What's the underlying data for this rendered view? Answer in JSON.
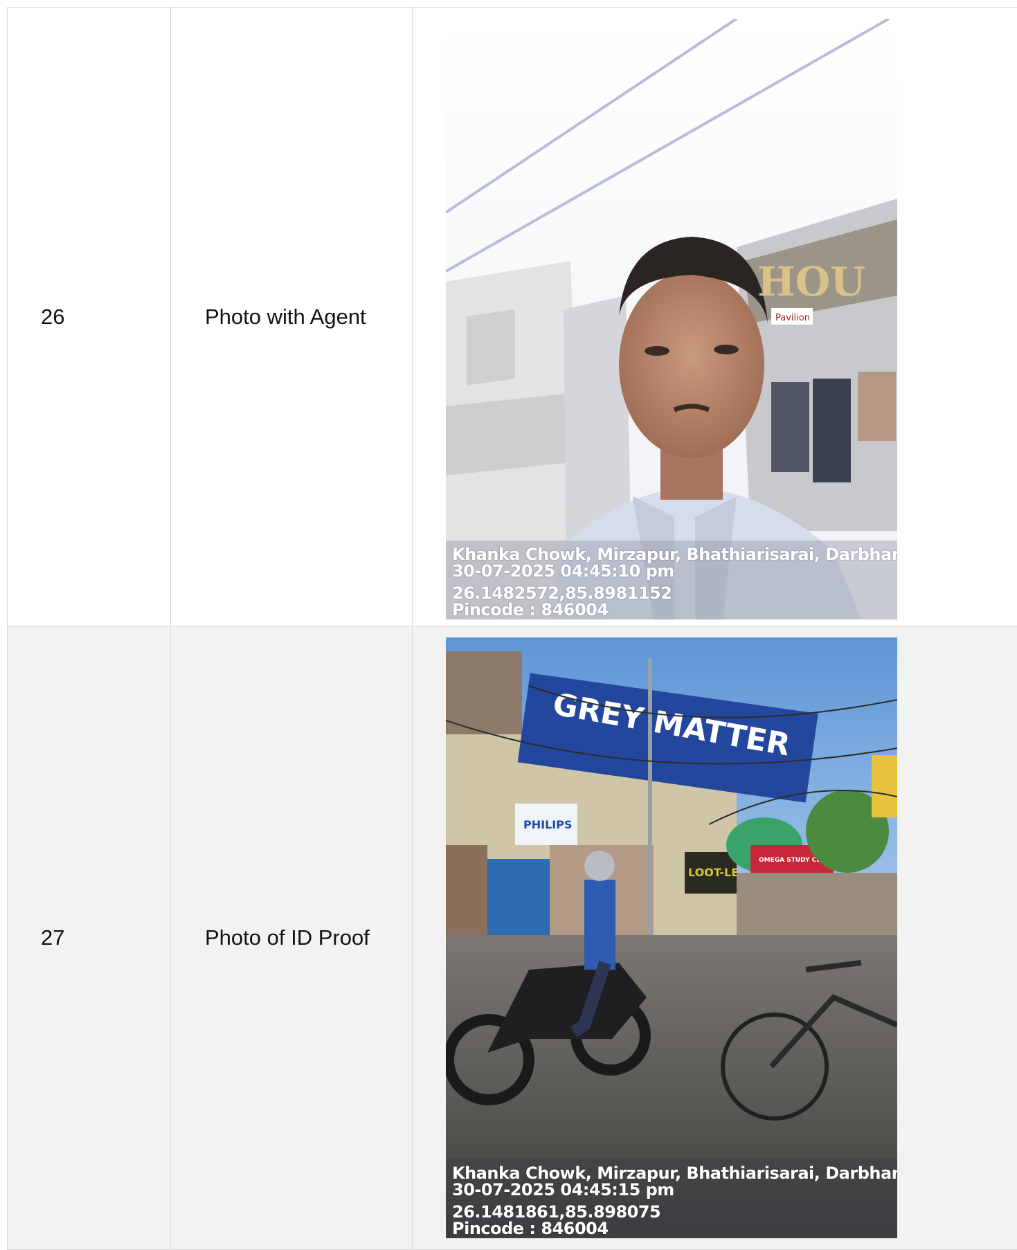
{
  "rows": [
    {
      "number": "26",
      "label": "Photo with Agent",
      "photo": {
        "address": "Khanka Chowk, Mirzapur, Bhathiarisarai, Darbhanga, Biha",
        "datetime": "30-07-2025 04:45:10 pm",
        "coordinates": "26.1482572,85.8981152",
        "pincode": "Pincode : 846004",
        "shop_sign": "HOU",
        "shop_label": "Pavilion"
      }
    },
    {
      "number": "27",
      "label": "Photo of ID Proof",
      "photo": {
        "address": "Khanka Chowk, Mirzapur, Bhathiarisarai, Darbhanga, Biha",
        "datetime": "30-07-2025 04:45:15 pm",
        "coordinates": "26.1481861,85.898075",
        "pincode": "Pincode : 846004",
        "sign_main": "GREY MATTER",
        "sign_philips": "PHILIPS",
        "sign_loot": "LOOT-LE",
        "sign_omega": "OMEGA STUDY CENTRE"
      }
    }
  ],
  "colors": {
    "border": "#d9d9d9",
    "alt_row_bg": "#f2f2f2",
    "text": "#111111"
  }
}
